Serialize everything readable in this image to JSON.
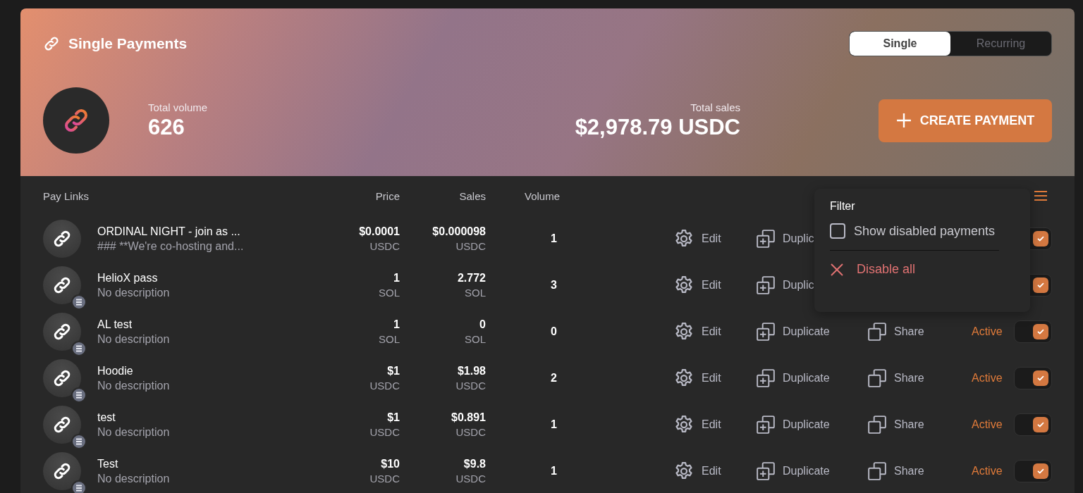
{
  "header": {
    "title": "Single Payments",
    "segments": [
      {
        "label": "Single",
        "selected": true
      },
      {
        "label": "Recurring",
        "selected": false
      }
    ],
    "total_volume": {
      "label": "Total volume",
      "value": "626"
    },
    "total_sales": {
      "label": "Total sales",
      "value": "$2,978.79 USDC"
    },
    "create_button": "CREATE PAYMENT"
  },
  "table": {
    "columns": [
      "Pay Links",
      "Price",
      "Sales",
      "Volume"
    ],
    "rows": [
      {
        "name": "ORDINAL NIGHT - join as ...",
        "description": "### **We're co-hosting and...",
        "badge": false,
        "price": "$0.0001",
        "price_currency": "USDC",
        "sales": "$0.000098",
        "sales_currency": "USDC",
        "volume": "1",
        "edit": "Edit",
        "duplicate": "Duplic",
        "on": true
      },
      {
        "name": "HelioX pass",
        "description": "No description",
        "badge": true,
        "price": "1",
        "price_currency": "SOL",
        "sales": "2.772",
        "sales_currency": "SOL",
        "volume": "3",
        "edit": "Edit",
        "duplicate": "Duplic",
        "on": true
      },
      {
        "name": "AL test",
        "description": "No description",
        "badge": true,
        "price": "1",
        "price_currency": "SOL",
        "sales": "0",
        "sales_currency": "SOL",
        "volume": "0",
        "edit": "Edit",
        "duplicate": "Duplicate",
        "share": "Share",
        "status": "Active",
        "on": true
      },
      {
        "name": "Hoodie",
        "description": "No description",
        "badge": true,
        "price": "$1",
        "price_currency": "USDC",
        "sales": "$1.98",
        "sales_currency": "USDC",
        "volume": "2",
        "edit": "Edit",
        "duplicate": "Duplicate",
        "share": "Share",
        "status": "Active",
        "on": true
      },
      {
        "name": "test",
        "description": "No description",
        "badge": true,
        "price": "$1",
        "price_currency": "USDC",
        "sales": "$0.891",
        "sales_currency": "USDC",
        "volume": "1",
        "edit": "Edit",
        "duplicate": "Duplicate",
        "share": "Share",
        "status": "Active",
        "on": true
      },
      {
        "name": "Test",
        "description": "No description",
        "badge": true,
        "price": "$10",
        "price_currency": "USDC",
        "sales": "$9.8",
        "sales_currency": "USDC",
        "volume": "1",
        "edit": "Edit",
        "duplicate": "Duplicate",
        "share": "Share",
        "status": "Active",
        "on": true
      }
    ]
  },
  "filter_menu": {
    "title": "Filter",
    "option": {
      "label": "Show disabled payments",
      "checked": false
    },
    "action": "Disable all"
  }
}
